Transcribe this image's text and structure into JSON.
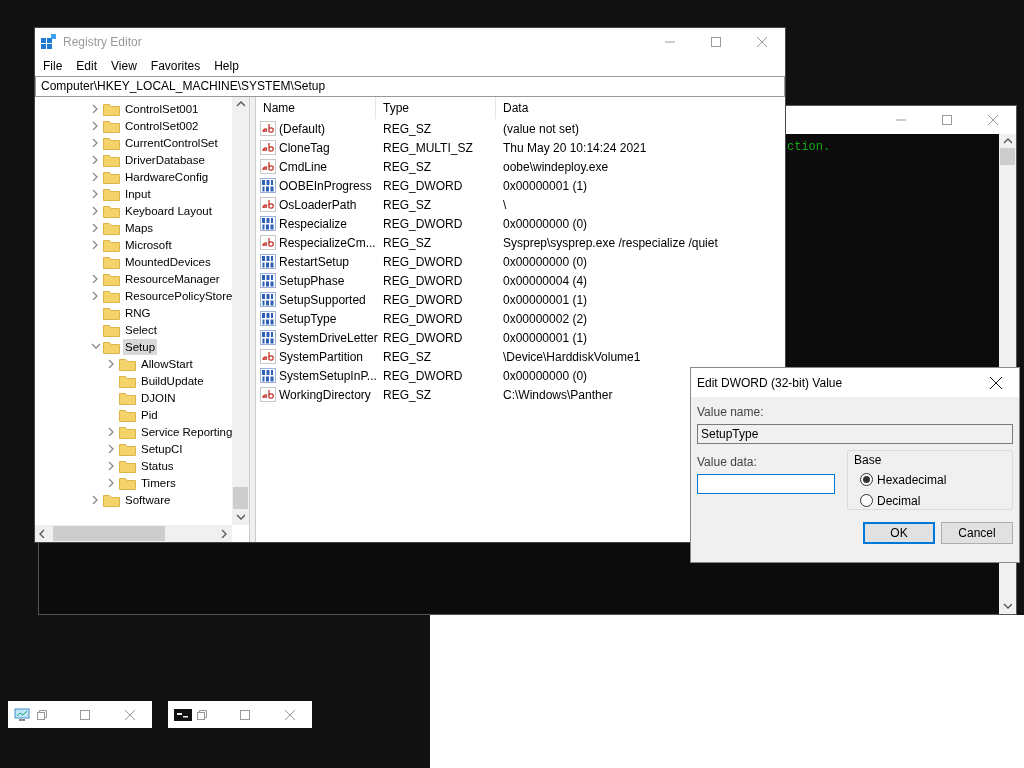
{
  "registry_editor": {
    "title": "Registry Editor",
    "menu": [
      "File",
      "Edit",
      "View",
      "Favorites",
      "Help"
    ],
    "address": "Computer\\HKEY_LOCAL_MACHINE\\SYSTEM\\Setup",
    "tree": [
      {
        "label": "ControlSet001",
        "expandable": true,
        "expanded": false,
        "selected": false
      },
      {
        "label": "ControlSet002",
        "expandable": true,
        "expanded": false,
        "selected": false
      },
      {
        "label": "CurrentControlSet",
        "expandable": true,
        "expanded": false,
        "selected": false
      },
      {
        "label": "DriverDatabase",
        "expandable": true,
        "expanded": false,
        "selected": false
      },
      {
        "label": "HardwareConfig",
        "expandable": true,
        "expanded": false,
        "selected": false
      },
      {
        "label": "Input",
        "expandable": true,
        "expanded": false,
        "selected": false
      },
      {
        "label": "Keyboard Layout",
        "expandable": true,
        "expanded": false,
        "selected": false
      },
      {
        "label": "Maps",
        "expandable": true,
        "expanded": false,
        "selected": false
      },
      {
        "label": "Microsoft",
        "expandable": true,
        "expanded": false,
        "selected": false
      },
      {
        "label": "MountedDevices",
        "expandable": false,
        "selected": false
      },
      {
        "label": "ResourceManager",
        "expandable": true,
        "expanded": false,
        "selected": false
      },
      {
        "label": "ResourcePolicyStore",
        "expandable": true,
        "expanded": false,
        "selected": false
      },
      {
        "label": "RNG",
        "expandable": false,
        "selected": false
      },
      {
        "label": "Select",
        "expandable": false,
        "selected": false
      },
      {
        "label": "Setup",
        "expandable": true,
        "expanded": true,
        "selected": true,
        "children": [
          {
            "label": "AllowStart",
            "expandable": true,
            "expanded": false,
            "selected": false
          },
          {
            "label": "BuildUpdate",
            "expandable": false,
            "selected": false
          },
          {
            "label": "DJOIN",
            "expandable": false,
            "selected": false
          },
          {
            "label": "Pid",
            "expandable": false,
            "selected": false
          },
          {
            "label": "Service Reporting",
            "expandable": true,
            "expanded": false,
            "selected": false
          },
          {
            "label": "SetupCI",
            "expandable": true,
            "expanded": false,
            "selected": false
          },
          {
            "label": "Status",
            "expandable": true,
            "expanded": false,
            "selected": false
          },
          {
            "label": "Timers",
            "expandable": true,
            "expanded": false,
            "selected": false
          }
        ]
      },
      {
        "label": "Software",
        "expandable": true,
        "expanded": false,
        "selected": false
      }
    ],
    "columns": [
      "Name",
      "Type",
      "Data"
    ],
    "values": [
      {
        "kind": "string",
        "name": "(Default)",
        "type": "REG_SZ",
        "data": "(value not set)"
      },
      {
        "kind": "string",
        "name": "CloneTag",
        "type": "REG_MULTI_SZ",
        "data": "Thu May 20 10:14:24 2021"
      },
      {
        "kind": "string",
        "name": "CmdLine",
        "type": "REG_SZ",
        "data": "oobe\\windeploy.exe"
      },
      {
        "kind": "binary",
        "name": "OOBEInProgress",
        "type": "REG_DWORD",
        "data": "0x00000001 (1)"
      },
      {
        "kind": "string",
        "name": "OsLoaderPath",
        "type": "REG_SZ",
        "data": "\\"
      },
      {
        "kind": "binary",
        "name": "Respecialize",
        "type": "REG_DWORD",
        "data": "0x00000000 (0)"
      },
      {
        "kind": "string",
        "name": "RespecializeCm...",
        "type": "REG_SZ",
        "data": "Sysprep\\sysprep.exe /respecialize /quiet"
      },
      {
        "kind": "binary",
        "name": "RestartSetup",
        "type": "REG_DWORD",
        "data": "0x00000000 (0)"
      },
      {
        "kind": "binary",
        "name": "SetupPhase",
        "type": "REG_DWORD",
        "data": "0x00000004 (4)"
      },
      {
        "kind": "binary",
        "name": "SetupSupported",
        "type": "REG_DWORD",
        "data": "0x00000001 (1)"
      },
      {
        "kind": "binary",
        "name": "SetupType",
        "type": "REG_DWORD",
        "data": "0x00000002 (2)"
      },
      {
        "kind": "binary",
        "name": "SystemDriveLetter",
        "type": "REG_DWORD",
        "data": "0x00000001 (1)"
      },
      {
        "kind": "string",
        "name": "SystemPartition",
        "type": "REG_SZ",
        "data": "\\Device\\HarddiskVolume1"
      },
      {
        "kind": "binary",
        "name": "SystemSetupInP...",
        "type": "REG_DWORD",
        "data": "0x00000000 (0)"
      },
      {
        "kind": "string",
        "name": "WorkingDirectory",
        "type": "REG_SZ",
        "data": "C:\\Windows\\Panther"
      }
    ]
  },
  "console": {
    "text": "ction."
  },
  "dialog": {
    "title": "Edit DWORD (32-bit) Value",
    "value_name_label": "Value name:",
    "value_name": "SetupType",
    "value_data_label": "Value data:",
    "base_label": "Base",
    "bases": [
      {
        "label": "Hexadecimal",
        "selected": true
      },
      {
        "label": "Decimal",
        "selected": false
      }
    ],
    "buttons": [
      {
        "label": "OK",
        "default": true
      },
      {
        "label": "Cancel",
        "default": false
      }
    ]
  },
  "minimized_windows": [
    {
      "kind": "registry"
    },
    {
      "kind": "console"
    }
  ]
}
